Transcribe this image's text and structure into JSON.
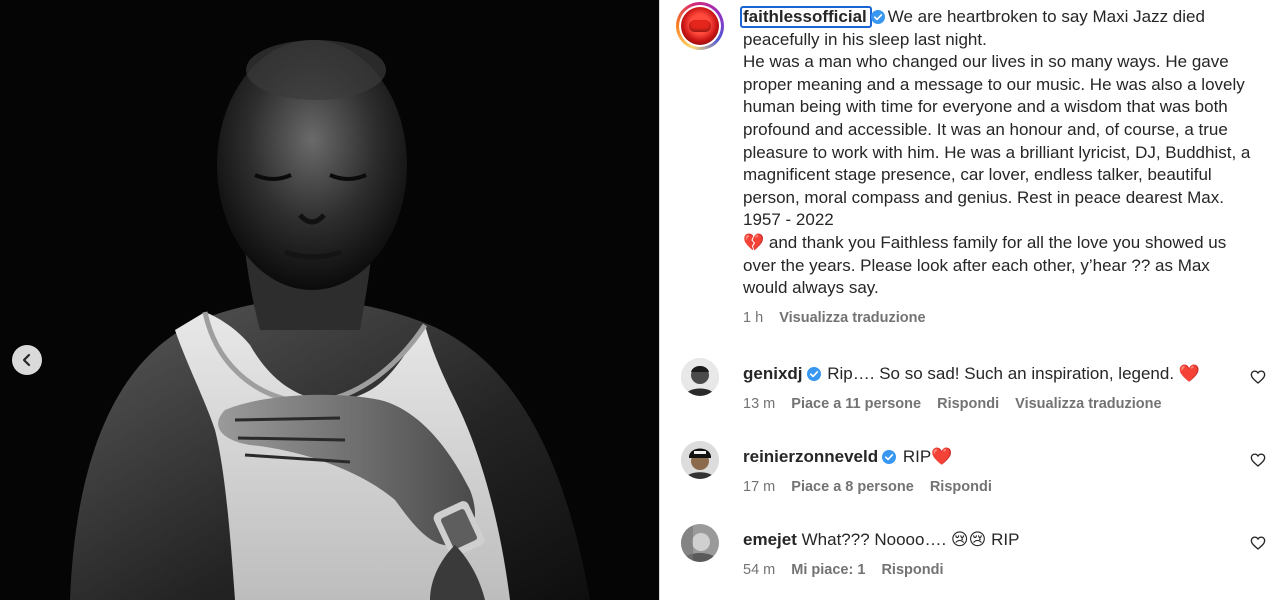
{
  "post": {
    "username": "faithlessofficial",
    "caption_line1": "We are heartbroken to say Maxi Jazz died peacefully in his sleep last night.",
    "caption_body_a": "He was a man who changed our lives in so many ways. He gave proper meaning and a message to our music. He was also a lovely human being with time for everyone and a wisdom that was both profound and accessible. It was an honour and, of course, a true pleasure to work with him. He was a brilliant lyricist, DJ, Buddhist, a magnificent stage presence, car lover, endless talker, beautiful person, moral compass and genius. Rest in peace dearest Max. 1957 - 2022",
    "caption_emoji": "💔",
    "caption_body_b": " and thank you Faithless family for all the love you showed us over the years. Please look after each other, y’hear ?? as Max would always say.",
    "time": "1 h",
    "translate": "Visualizza traduzione"
  },
  "comments": [
    {
      "username": "genixdj",
      "text": "Rip…. So so sad! Such an inspiration, legend. ",
      "emoji": "❤️",
      "time": "13 m",
      "likes": "Piace a 11 persone",
      "reply": "Rispondi",
      "translate": "Visualizza traduzione"
    },
    {
      "username": "reinierzonneveld",
      "text": "RIP",
      "emoji": "❤️",
      "time": "17 m",
      "likes": "Piace a 8 persone",
      "reply": "Rispondi"
    },
    {
      "username": "emejet",
      "text": "What??? Noooo…. ",
      "emoji": "😢😢",
      "text_after": " RIP",
      "time": "54 m",
      "likes": "Mi piace: 1",
      "reply": "Rispondi"
    }
  ],
  "icons": {
    "verified": "verified-badge-icon",
    "nav_prev": "chevron-left-icon",
    "like": "heart-outline-icon"
  },
  "colors": {
    "verified": "#3897f0",
    "link_focus": "#1b64d4",
    "muted": "#737373"
  }
}
